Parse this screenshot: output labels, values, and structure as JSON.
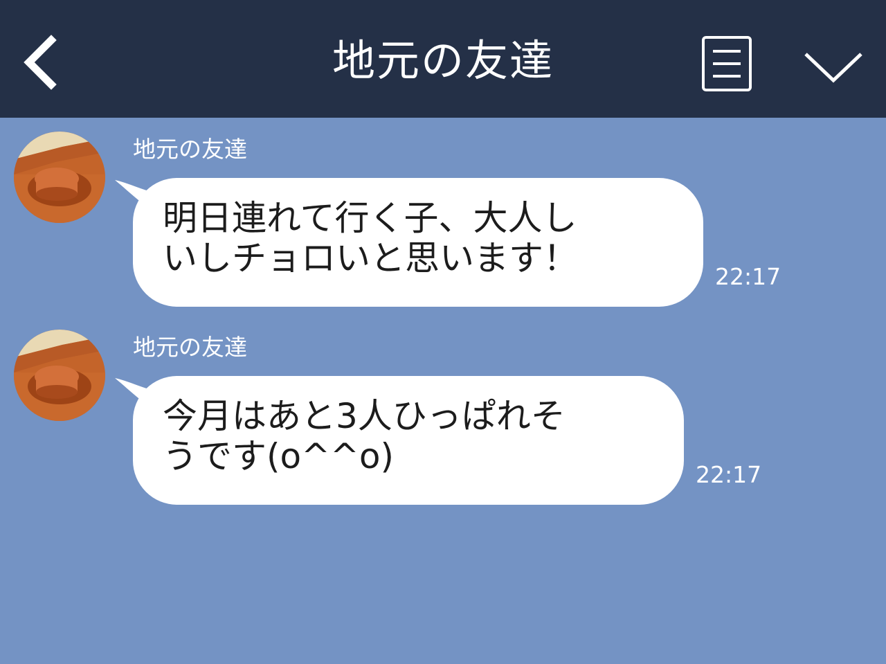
{
  "header": {
    "title": "地元の友達",
    "back_icon": "chevron-left-icon",
    "menu_icon": "menu-list-icon",
    "dropdown_icon": "chevron-down-icon",
    "background": "#243047"
  },
  "chat": {
    "background": "#7493c4",
    "messages": [
      {
        "sender": "地元の友達",
        "text": "明日連れて行く子、大人し\nいしチョロいと思います！",
        "time": "22:17"
      },
      {
        "sender": "地元の友達",
        "text": "今月はあと3人ひっぱれそ\nうです(o^^o)",
        "time": "22:17"
      }
    ]
  }
}
